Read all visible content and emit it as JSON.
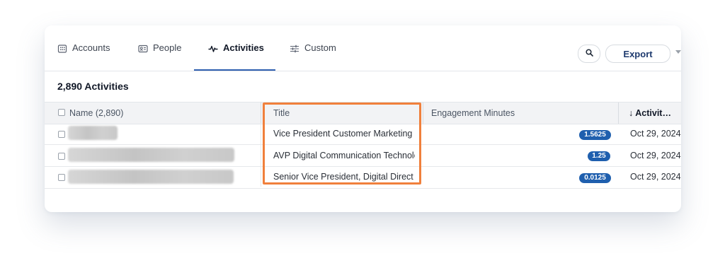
{
  "tabs": [
    {
      "label": "Accounts",
      "icon": "building-icon"
    },
    {
      "label": "People",
      "icon": "id-card-icon"
    },
    {
      "label": "Activities",
      "icon": "pulse-icon",
      "active": true
    },
    {
      "label": "Custom",
      "icon": "sliders-icon"
    }
  ],
  "toolbar": {
    "export_label": "Export"
  },
  "summary": {
    "count_title": "2,890 Activities"
  },
  "table": {
    "headers": {
      "name": "Name (2,890)",
      "title": "Title",
      "engagement": "Engagement Minutes",
      "activity": "Activit…"
    },
    "rows": [
      {
        "title": "Vice President Customer Marketing",
        "engagement": "1.5625",
        "date": "Oct 29, 2024"
      },
      {
        "title": "AVP Digital Communication Technology",
        "engagement": "1.25",
        "date": "Oct 29, 2024"
      },
      {
        "title": "Senior Vice President, Digital Direct",
        "engagement": "0.0125",
        "date": "Oct 29, 2024"
      }
    ]
  },
  "colors": {
    "accent": "#2f5fb0",
    "badge": "#1f5fae",
    "highlight": "#f0803c"
  }
}
